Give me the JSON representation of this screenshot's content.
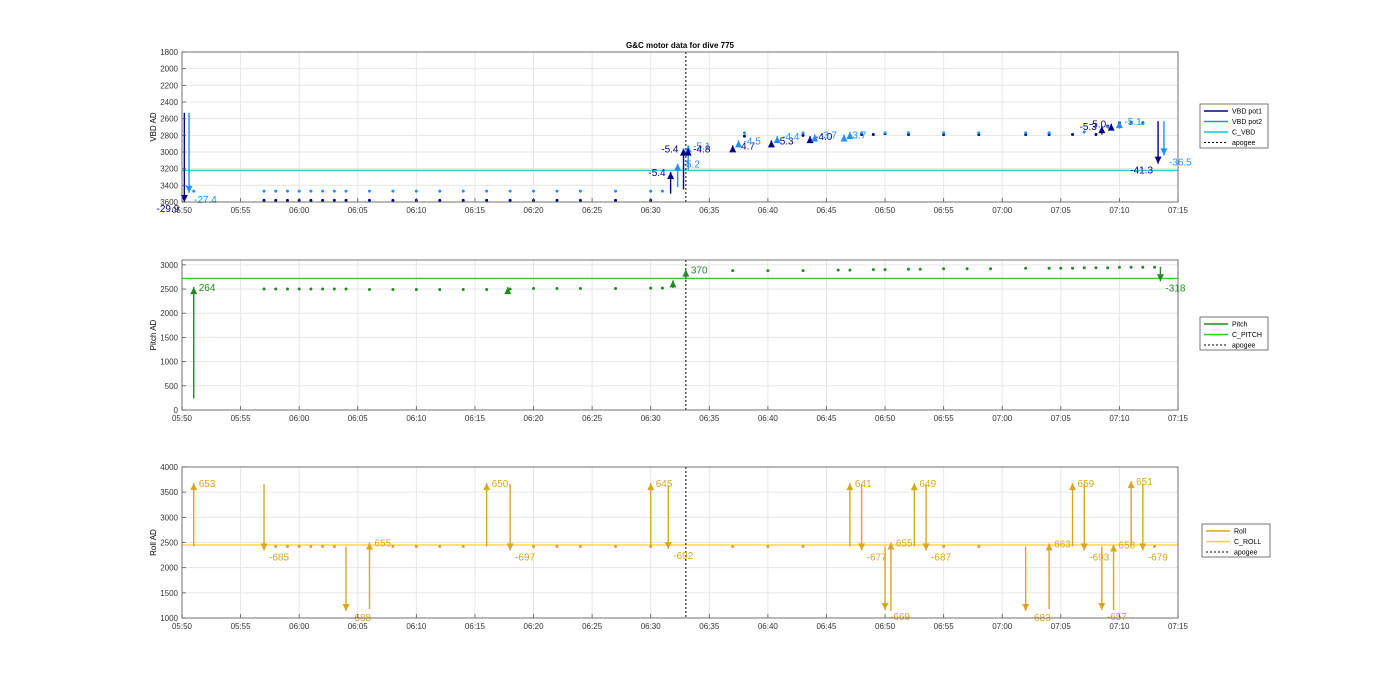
{
  "figure": {
    "title": "G&C motor data for dive 775"
  },
  "colors": {
    "vbd_pot1": "#00008b",
    "vbd_pot2": "#1e90ff",
    "c_vbd": "#00cccc",
    "pitch": "#228b22",
    "c_pitch": "#33cc33",
    "roll": "#daa520",
    "c_roll": "#ffd700",
    "apogee": "#000000",
    "grid": "#e6e6e6",
    "axis": "#000000"
  },
  "chart_data": [
    {
      "type": "scatter",
      "ylabel": "VBD AD",
      "y_reversed": true,
      "ylim": [
        1800,
        3600
      ],
      "yticks": [
        1800,
        2000,
        2200,
        2400,
        2600,
        2800,
        3000,
        3200,
        3400,
        3600
      ],
      "xlim": [
        "05:50",
        "07:15"
      ],
      "xticks": [
        "05:50",
        "05:55",
        "06:00",
        "06:05",
        "06:10",
        "06:15",
        "06:20",
        "06:25",
        "06:30",
        "06:35",
        "06:40",
        "06:45",
        "06:50",
        "06:55",
        "07:00",
        "07:05",
        "07:10",
        "07:15"
      ],
      "grid": true,
      "legend_position": "right",
      "legend": [
        {
          "label": "VBD pot1",
          "color_key": "vbd_pot1",
          "style": "solid"
        },
        {
          "label": "VBD pot2",
          "color_key": "vbd_pot2",
          "style": "solid"
        },
        {
          "label": "C_VBD",
          "color_key": "c_vbd",
          "style": "solid"
        },
        {
          "label": "apogee",
          "color_key": "apogee",
          "style": "dotted"
        }
      ],
      "reference_lines": [
        {
          "name": "C_VBD",
          "y": 3220,
          "color_key": "c_vbd"
        }
      ],
      "apogee_x": "06:33",
      "series": [
        {
          "name": "VBD pot1",
          "color_key": "vbd_pot1",
          "x": [
            "05:57",
            "05:58",
            "05:59",
            "06:00",
            "06:01",
            "06:02",
            "06:03",
            "06:04",
            "06:06",
            "06:08",
            "06:10",
            "06:12",
            "06:14",
            "06:16",
            "06:18",
            "06:20",
            "06:22",
            "06:24",
            "06:27",
            "06:30",
            "06:38",
            "06:43",
            "06:48",
            "06:49",
            "06:50",
            "06:52",
            "06:55",
            "06:58",
            "07:02",
            "07:04",
            "07:06",
            "07:08",
            "07:09",
            "07:10",
            "07:11",
            "07:12"
          ],
          "y": [
            3580,
            3580,
            3580,
            3580,
            3580,
            3580,
            3580,
            3580,
            3580,
            3580,
            3580,
            3580,
            3580,
            3580,
            3580,
            3580,
            3580,
            3580,
            3580,
            3580,
            2810,
            2800,
            2790,
            2790,
            2780,
            2790,
            2790,
            2790,
            2790,
            2790,
            2790,
            2790,
            2690,
            2650,
            2650,
            2650
          ]
        },
        {
          "name": "VBD pot2",
          "color_key": "vbd_pot2",
          "x": [
            "05:51",
            "05:57",
            "05:58",
            "05:59",
            "06:00",
            "06:01",
            "06:02",
            "06:03",
            "06:04",
            "06:06",
            "06:08",
            "06:10",
            "06:12",
            "06:14",
            "06:16",
            "06:18",
            "06:20",
            "06:22",
            "06:24",
            "06:27",
            "06:30",
            "06:31",
            "06:38",
            "06:43",
            "06:48",
            "06:50",
            "06:52",
            "06:55",
            "06:58",
            "07:02",
            "07:04",
            "07:07",
            "07:09",
            "07:10",
            "07:11",
            "07:12"
          ],
          "y": [
            3470,
            3470,
            3470,
            3470,
            3470,
            3470,
            3470,
            3470,
            3470,
            3470,
            3470,
            3470,
            3470,
            3470,
            3470,
            3470,
            3470,
            3470,
            3470,
            3470,
            3470,
            3470,
            2770,
            2770,
            2770,
            2770,
            2770,
            2770,
            2770,
            2770,
            2770,
            2760,
            2700,
            2680,
            2660,
            2660
          ]
        }
      ],
      "moves": [
        {
          "x": "05:50.2",
          "from": 2530,
          "to": 3600,
          "label": "-29.9",
          "color_key": "vbd_pot1",
          "label_side": "left"
        },
        {
          "x": "05:50.6",
          "from": 2530,
          "to": 3490,
          "label": "-27.4",
          "color_key": "vbd_pot2",
          "label_side": "right"
        },
        {
          "x": "06:31.7",
          "from": 3500,
          "to": 3240,
          "label": "-5.4",
          "color_key": "vbd_pot1",
          "label_side": "left"
        },
        {
          "x": "06:32.3",
          "from": 3420,
          "to": 3140,
          "label": "-5.2",
          "color_key": "vbd_pot2",
          "label_side": "right"
        },
        {
          "x": "06:32.8",
          "from": 3450,
          "to": 2960,
          "label": "-5.4",
          "color_key": "vbd_pot1",
          "label_side": "left"
        },
        {
          "x": "06:33.2",
          "from": 3210,
          "to": 2920,
          "label": "-5.1",
          "color_key": "vbd_pot2",
          "label_side": "right"
        },
        {
          "x": "06:33.2",
          "from": 3000,
          "to": 2960,
          "label": "-4.8",
          "color_key": "vbd_pot1",
          "label_side": "right"
        },
        {
          "x": "06:37",
          "from": 3000,
          "to": 2920,
          "label": "-4.7",
          "color_key": "vbd_pot1",
          "label_side": "right"
        },
        {
          "x": "06:37.5",
          "from": 2920,
          "to": 2860,
          "label": "-4.5",
          "color_key": "vbd_pot2",
          "label_side": "right"
        },
        {
          "x": "06:40.3",
          "from": 2930,
          "to": 2860,
          "label": "-5.3",
          "color_key": "vbd_pot1",
          "label_side": "right"
        },
        {
          "x": "06:40.8",
          "from": 2870,
          "to": 2810,
          "label": "-4.4",
          "color_key": "vbd_pot2",
          "label_side": "right"
        },
        {
          "x": "06:43.6",
          "from": 2870,
          "to": 2810,
          "label": "-4.0",
          "color_key": "vbd_pot1",
          "label_side": "right"
        },
        {
          "x": "06:44",
          "from": 2830,
          "to": 2790,
          "label": "-3.7",
          "color_key": "vbd_pot2",
          "label_side": "right"
        },
        {
          "x": "06:46.5",
          "from": 2840,
          "to": 2790,
          "label": "-3.7",
          "color_key": "vbd_pot2",
          "label_side": "right"
        },
        {
          "x": "06:47",
          "from": 2810,
          "to": 2760,
          "label": "",
          "color_key": "vbd_pot2",
          "label_side": "right"
        },
        {
          "x": "07:08.5",
          "from": 2790,
          "to": 2690,
          "label": "-5.3",
          "color_key": "vbd_pot1",
          "label_side": "left"
        },
        {
          "x": "07:09.3",
          "from": 2740,
          "to": 2660,
          "label": "-5.0",
          "color_key": "vbd_pot1",
          "label_side": "left"
        },
        {
          "x": "07:10",
          "from": 2720,
          "to": 2630,
          "label": "-5.1",
          "color_key": "vbd_pot2",
          "label_side": "right"
        },
        {
          "x": "07:13.3",
          "from": 2630,
          "to": 3140,
          "label": "-41.3",
          "color_key": "vbd_pot1",
          "label_side": "left"
        },
        {
          "x": "07:13.8",
          "from": 2630,
          "to": 3040,
          "label": "-36.5",
          "color_key": "vbd_pot2",
          "label_side": "right"
        }
      ]
    },
    {
      "type": "scatter",
      "ylabel": "Pitch AD",
      "ylim": [
        0,
        3100
      ],
      "yticks": [
        0,
        500,
        1000,
        1500,
        2000,
        2500,
        3000
      ],
      "xlim": [
        "05:50",
        "07:15"
      ],
      "xticks": [
        "05:50",
        "05:55",
        "06:00",
        "06:05",
        "06:10",
        "06:15",
        "06:20",
        "06:25",
        "06:30",
        "06:35",
        "06:40",
        "06:45",
        "06:50",
        "06:55",
        "07:00",
        "07:05",
        "07:10",
        "07:15"
      ],
      "grid": true,
      "legend_position": "right",
      "legend": [
        {
          "label": "Pitch",
          "color_key": "pitch",
          "style": "solid"
        },
        {
          "label": "C_PITCH",
          "color_key": "c_pitch",
          "style": "solid"
        },
        {
          "label": "apogee",
          "color_key": "apogee",
          "style": "dotted"
        }
      ],
      "reference_lines": [
        {
          "name": "C_PITCH",
          "y": 2720,
          "color_key": "c_pitch"
        }
      ],
      "apogee_x": "06:33",
      "series": [
        {
          "name": "Pitch",
          "color_key": "pitch",
          "x": [
            "05:57",
            "05:58",
            "05:59",
            "06:00",
            "06:01",
            "06:02",
            "06:03",
            "06:04",
            "06:06",
            "06:08",
            "06:10",
            "06:12",
            "06:14",
            "06:16",
            "06:18",
            "06:20",
            "06:22",
            "06:24",
            "06:27",
            "06:30",
            "06:31",
            "06:37",
            "06:40",
            "06:43",
            "06:46",
            "06:47",
            "06:49",
            "06:50",
            "06:52",
            "06:53",
            "06:55",
            "06:57",
            "06:59",
            "07:02",
            "07:04",
            "07:05",
            "07:06",
            "07:07",
            "07:08",
            "07:09",
            "07:10",
            "07:11",
            "07:12",
            "07:13"
          ],
          "y": [
            2500,
            2500,
            2500,
            2500,
            2500,
            2500,
            2500,
            2500,
            2490,
            2490,
            2490,
            2490,
            2490,
            2490,
            2500,
            2510,
            2510,
            2510,
            2510,
            2520,
            2520,
            2880,
            2880,
            2880,
            2890,
            2890,
            2900,
            2900,
            2910,
            2910,
            2920,
            2920,
            2920,
            2930,
            2930,
            2930,
            2930,
            2940,
            2940,
            2940,
            2950,
            2950,
            2950,
            2950
          ]
        }
      ],
      "moves": [
        {
          "x": "05:51",
          "from": 240,
          "to": 2540,
          "label": "264",
          "color_key": "pitch",
          "label_side": "right"
        },
        {
          "x": "06:17.8",
          "from": 2480,
          "to": 2540,
          "label": "",
          "color_key": "pitch",
          "label_side": "right"
        },
        {
          "x": "06:31.9",
          "from": 2520,
          "to": 2680,
          "label": "",
          "color_key": "pitch",
          "label_side": "right"
        },
        {
          "x": "06:33",
          "from": 2700,
          "to": 2900,
          "label": "370",
          "color_key": "pitch",
          "label_side": "right"
        },
        {
          "x": "07:13.5",
          "from": 2960,
          "to": 2660,
          "label": "-318",
          "color_key": "pitch",
          "label_side": "right"
        }
      ]
    },
    {
      "type": "scatter",
      "ylabel": "Roll AD",
      "ylim": [
        1000,
        4000
      ],
      "yticks": [
        1000,
        1500,
        2000,
        2500,
        3000,
        3500,
        4000
      ],
      "xlim": [
        "05:50",
        "07:15"
      ],
      "xticks": [
        "05:50",
        "05:55",
        "06:00",
        "06:05",
        "06:10",
        "06:15",
        "06:20",
        "06:25",
        "06:30",
        "06:35",
        "06:40",
        "06:45",
        "06:50",
        "06:55",
        "07:00",
        "07:05",
        "07:10",
        "07:15"
      ],
      "grid": true,
      "legend_position": "right",
      "legend": [
        {
          "label": "Roll",
          "color_key": "roll",
          "style": "solid"
        },
        {
          "label": "C_ROLL",
          "color_key": "c_roll",
          "style": "solid"
        },
        {
          "label": "apogee",
          "color_key": "apogee",
          "style": "dotted"
        }
      ],
      "reference_lines": [
        {
          "name": "C_ROLL",
          "y": 2450,
          "color_key": "c_roll"
        }
      ],
      "apogee_x": "06:33",
      "series": [
        {
          "name": "Roll",
          "color_key": "roll",
          "x": [
            "05:58",
            "05:59",
            "06:00",
            "06:01",
            "06:02",
            "06:03",
            "06:08",
            "06:10",
            "06:12",
            "06:14",
            "06:20",
            "06:22",
            "06:24",
            "06:27",
            "06:30",
            "06:37",
            "06:40",
            "06:43",
            "06:55",
            "06:58",
            "07:13"
          ],
          "y": [
            2420,
            2420,
            2420,
            2420,
            2420,
            2420,
            2420,
            2420,
            2420,
            2420,
            2420,
            2420,
            2420,
            2420,
            2420,
            2420,
            2420,
            2420,
            2420,
            2420,
            2420
          ]
        }
      ],
      "moves": [
        {
          "x": "05:51",
          "from": 2420,
          "to": 3680,
          "label": "653",
          "color_key": "roll",
          "label_side": "right"
        },
        {
          "x": "05:57",
          "from": 3660,
          "to": 2340,
          "label": "-685",
          "color_key": "roll",
          "label_side": "right"
        },
        {
          "x": "06:04",
          "from": 2420,
          "to": 1140,
          "label": "-688",
          "color_key": "roll",
          "label_side": "right"
        },
        {
          "x": "06:06",
          "from": 1180,
          "to": 2500,
          "label": "655",
          "color_key": "roll",
          "label_side": "right"
        },
        {
          "x": "06:16",
          "from": 2420,
          "to": 3680,
          "label": "650",
          "color_key": "roll",
          "label_side": "right"
        },
        {
          "x": "06:18",
          "from": 3660,
          "to": 2340,
          "label": "-697",
          "color_key": "roll",
          "label_side": "right"
        },
        {
          "x": "06:30",
          "from": 2420,
          "to": 3680,
          "label": "645",
          "color_key": "roll",
          "label_side": "right"
        },
        {
          "x": "06:31.5",
          "from": 3640,
          "to": 2370,
          "label": "-692",
          "color_key": "roll",
          "label_side": "right"
        },
        {
          "x": "06:47",
          "from": 2420,
          "to": 3680,
          "label": "641",
          "color_key": "roll",
          "label_side": "right"
        },
        {
          "x": "06:48",
          "from": 3660,
          "to": 2340,
          "label": "-677",
          "color_key": "roll",
          "label_side": "right"
        },
        {
          "x": "06:50",
          "from": 2420,
          "to": 1160,
          "label": "-669",
          "color_key": "roll",
          "label_side": "right"
        },
        {
          "x": "06:50.5",
          "from": 1140,
          "to": 2500,
          "label": "655",
          "color_key": "roll",
          "label_side": "right"
        },
        {
          "x": "06:52.5",
          "from": 2420,
          "to": 3680,
          "label": "649",
          "color_key": "roll",
          "label_side": "right"
        },
        {
          "x": "06:53.5",
          "from": 3660,
          "to": 2340,
          "label": "-687",
          "color_key": "roll",
          "label_side": "right"
        },
        {
          "x": "07:02",
          "from": 2420,
          "to": 1140,
          "label": "-683",
          "color_key": "roll",
          "label_side": "right"
        },
        {
          "x": "07:04",
          "from": 1180,
          "to": 2480,
          "label": "663",
          "color_key": "roll",
          "label_side": "right"
        },
        {
          "x": "07:06",
          "from": 2420,
          "to": 3680,
          "label": "659",
          "color_key": "roll",
          "label_side": "right"
        },
        {
          "x": "07:07",
          "from": 3660,
          "to": 2340,
          "label": "-693",
          "color_key": "roll",
          "label_side": "right"
        },
        {
          "x": "07:08.5",
          "from": 2420,
          "to": 1160,
          "label": "-657",
          "color_key": "roll",
          "label_side": "right"
        },
        {
          "x": "07:09.5",
          "from": 1160,
          "to": 2460,
          "label": "658",
          "color_key": "roll",
          "label_side": "right"
        },
        {
          "x": "07:11",
          "from": 2420,
          "to": 3720,
          "label": "651",
          "color_key": "roll",
          "label_side": "right"
        },
        {
          "x": "07:12",
          "from": 3660,
          "to": 2340,
          "label": "-679",
          "color_key": "roll",
          "label_side": "right"
        }
      ]
    }
  ]
}
